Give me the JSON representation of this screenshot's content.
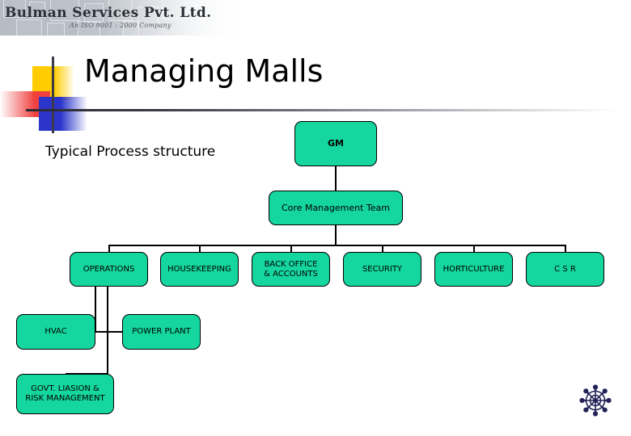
{
  "header": {
    "logo_title": "Bulman Services Pvt. Ltd.",
    "logo_subtitle": "An ISO 9001 : 2000 Company"
  },
  "slide": {
    "title": "Managing Malls",
    "subtitle": "Typical Process structure"
  },
  "colors": {
    "node_fill": "#14d69e",
    "node_border": "#000000",
    "accent_yellow": "#ffcc00",
    "accent_red": "#f04040",
    "accent_blue": "#2b35cc",
    "wheel": "#232359"
  },
  "chart_data": {
    "type": "diagram",
    "title": "Typical Process structure",
    "nodes": [
      {
        "id": "gm",
        "label": "GM",
        "level": 0
      },
      {
        "id": "cmt",
        "label": "Core Management Team",
        "level": 1
      },
      {
        "id": "ops",
        "label": "OPERATIONS",
        "level": 2
      },
      {
        "id": "hk",
        "label": "HOUSEKEEPING",
        "level": 2
      },
      {
        "id": "boa",
        "label": "BACK OFFICE & ACCOUNTS",
        "level": 2
      },
      {
        "id": "sec",
        "label": "SECURITY",
        "level": 2
      },
      {
        "id": "hort",
        "label": "HORTICULTURE",
        "level": 2
      },
      {
        "id": "csr",
        "label": "C S R",
        "level": 2
      },
      {
        "id": "hvac",
        "label": "HVAC",
        "level": 3
      },
      {
        "id": "pp",
        "label": "POWER PLANT",
        "level": 3
      },
      {
        "id": "govt",
        "label": "GOVT. LIASION & RISK MANAGEMENT",
        "level": 4
      }
    ],
    "edges": [
      {
        "from": "gm",
        "to": "cmt"
      },
      {
        "from": "cmt",
        "to": "ops"
      },
      {
        "from": "cmt",
        "to": "hk"
      },
      {
        "from": "cmt",
        "to": "boa"
      },
      {
        "from": "cmt",
        "to": "sec"
      },
      {
        "from": "cmt",
        "to": "hort"
      },
      {
        "from": "cmt",
        "to": "csr"
      },
      {
        "from": "ops",
        "to": "hvac"
      },
      {
        "from": "ops",
        "to": "pp"
      },
      {
        "from": "ops",
        "to": "govt"
      }
    ]
  },
  "nodes": {
    "gm": "GM",
    "cmt": "Core Management Team",
    "operations": "OPERATIONS",
    "housekeeping": "HOUSEKEEPING",
    "back_office_line1": "BACK OFFICE",
    "back_office_line2": "& ACCOUNTS",
    "security": "SECURITY",
    "horticulture": "HORTICULTURE",
    "csr": "C S R",
    "hvac": "HVAC",
    "power_plant": "POWER PLANT",
    "govt_line1": "GOVT. LIASION &",
    "govt_line2": "RISK  MANAGEMENT"
  },
  "icons": {
    "wheel": "ships-wheel-icon"
  }
}
